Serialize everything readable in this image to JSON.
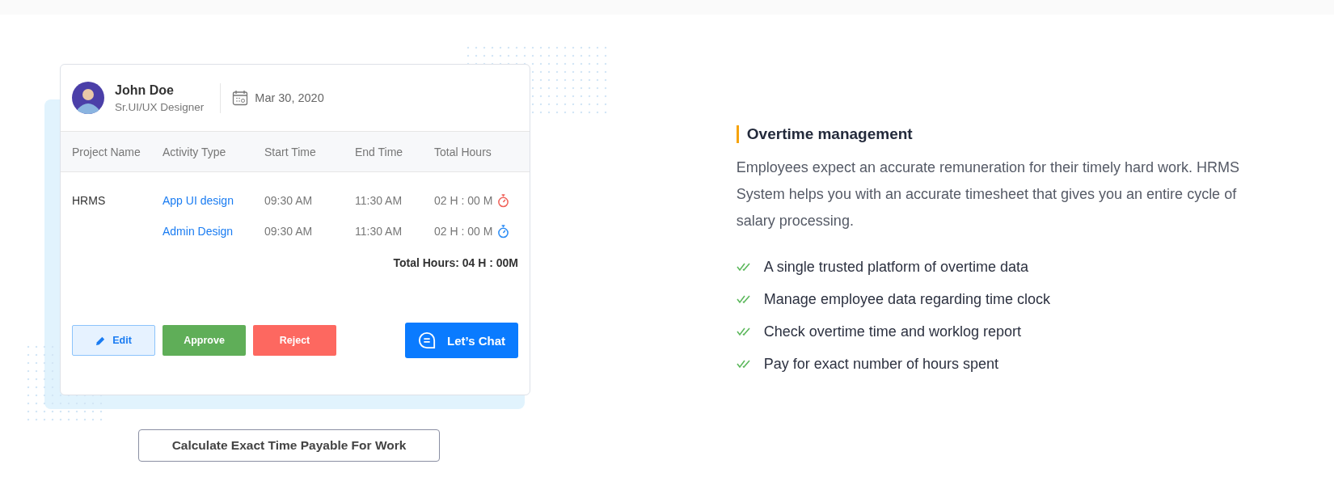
{
  "timesheet_card": {
    "user": {
      "name": "John Doe",
      "role": "Sr.UI/UX Designer"
    },
    "date": "Mar 30, 2020",
    "table": {
      "columns": [
        "Project Name",
        "Activity Type",
        "Start Time",
        "End Time",
        "Total Hours"
      ],
      "rows": [
        {
          "project": "HRMS",
          "activity": "App UI design",
          "start": "09:30 AM",
          "end": "11:30 AM",
          "total": "02 H : 00 M",
          "color": "#f0625a"
        },
        {
          "project": "",
          "activity": "Admin Design",
          "start": "09:30 AM",
          "end": "11:30 AM",
          "total": "02 H : 00 M",
          "color": "#2b8cf5"
        }
      ]
    },
    "total": "Total Hours: 04 H : 00M",
    "buttons": [
      {
        "label": "Edit",
        "kind": "edit"
      },
      {
        "label": "Approve",
        "kind": "approve"
      },
      {
        "label": "Reject",
        "kind": "reject"
      }
    ],
    "chat_button": "Let’s Chat"
  },
  "caption_button": "Calculate Exact Time Payable For Work",
  "feature": {
    "title": "Overtime management",
    "description": "Employees expect an accurate remuneration for their timely hard work. HRMS System helps you with an accurate timesheet that gives you an entire cycle of salary processing.",
    "points": [
      "A single trusted platform of overtime data",
      "Manage employee data regarding time clock",
      "Check overtime time and worklog report",
      "Pay for exact number of hours spent"
    ]
  }
}
